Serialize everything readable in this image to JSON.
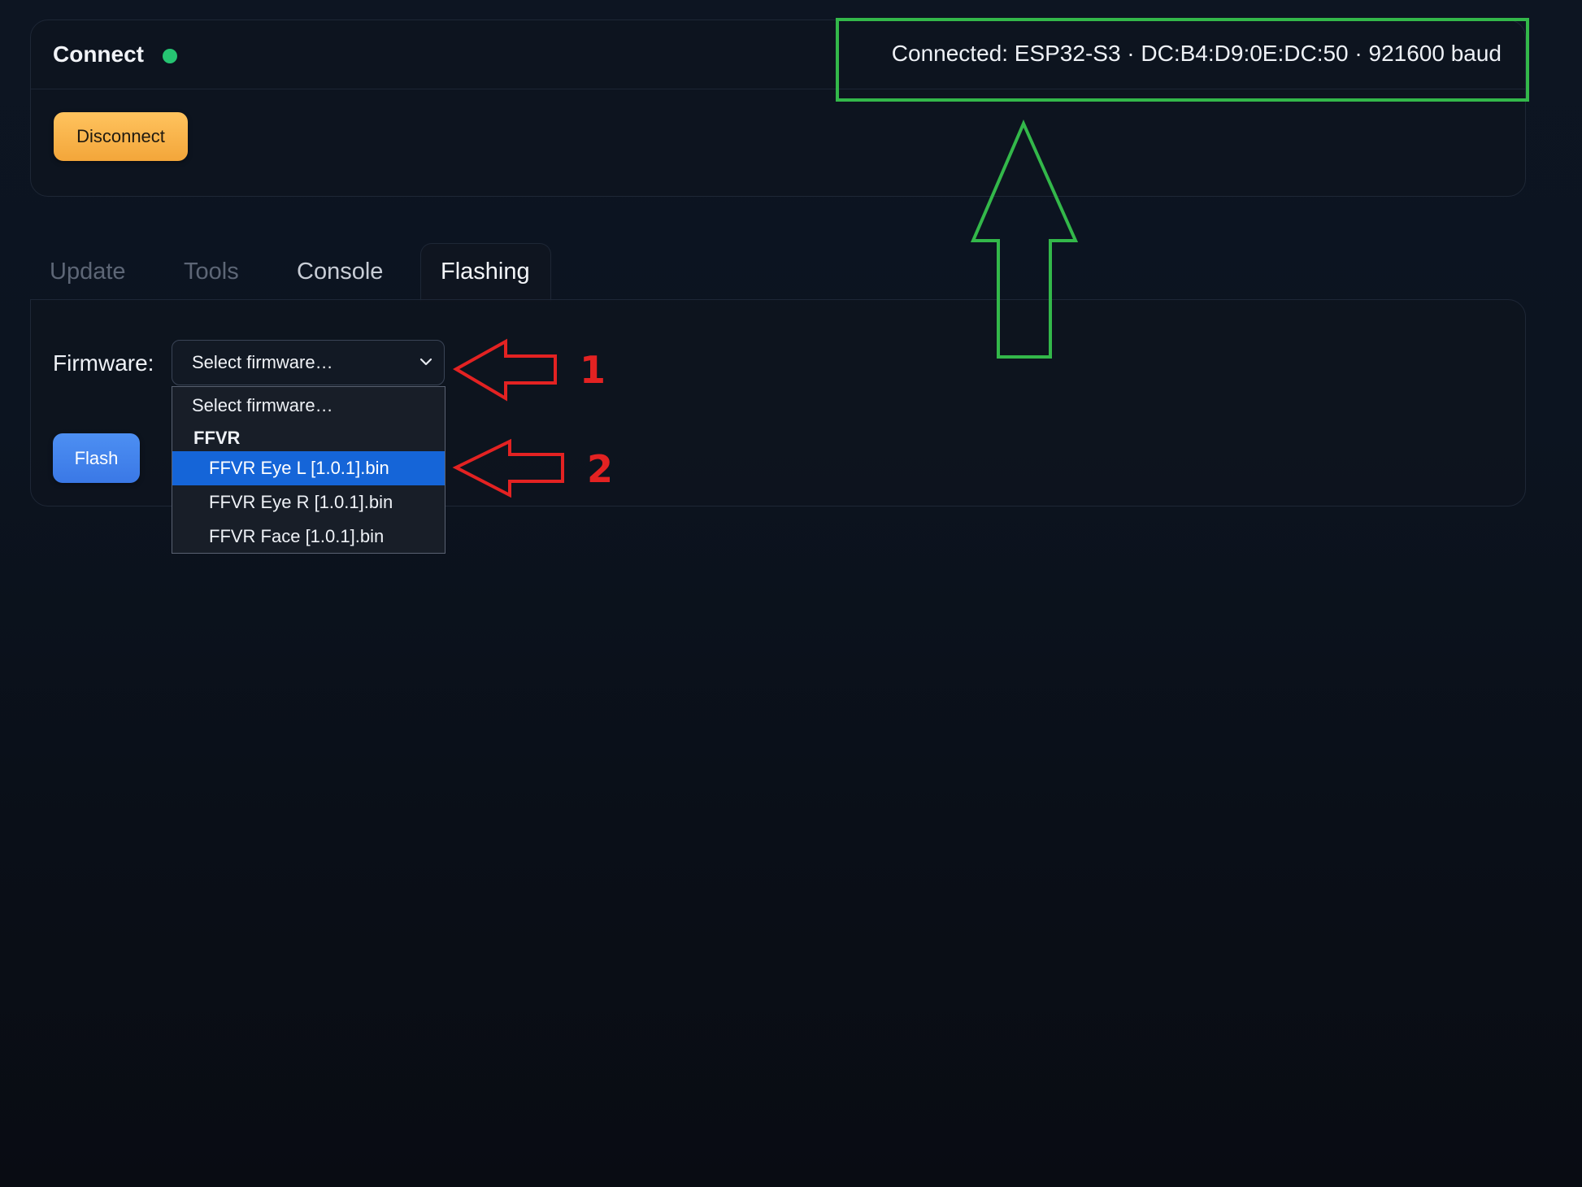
{
  "connect": {
    "title": "Connect",
    "status_text": "Connected: ESP32-S3 · DC:B4:D9:0E:DC:50 · 921600 baud",
    "status_color": "#26c472",
    "disconnect_label": "Disconnect"
  },
  "tabs": [
    {
      "label": "Update",
      "active": false
    },
    {
      "label": "Tools",
      "active": false
    },
    {
      "label": "Console",
      "active": false
    },
    {
      "label": "Flashing",
      "active": true
    }
  ],
  "flashing": {
    "firmware_label": "Firmware:",
    "select_value": "Select firmware…",
    "flash_label": "Flash",
    "dropdown": {
      "placeholder": "Select firmware…",
      "group": "FFVR",
      "options": [
        {
          "label": "FFVR Eye L [1.0.1].bin",
          "selected": true
        },
        {
          "label": "FFVR Eye R [1.0.1].bin",
          "selected": false
        },
        {
          "label": "FFVR Face [1.0.1].bin",
          "selected": false
        }
      ]
    }
  },
  "annotations": {
    "marker_1": "1",
    "marker_2": "2",
    "red_color": "#e32222",
    "green_color": "#33b84a"
  },
  "colors": {
    "accent_blue": "#3a78e6",
    "accent_orange": "#f3a63a",
    "selected_option": "#1565d8"
  }
}
